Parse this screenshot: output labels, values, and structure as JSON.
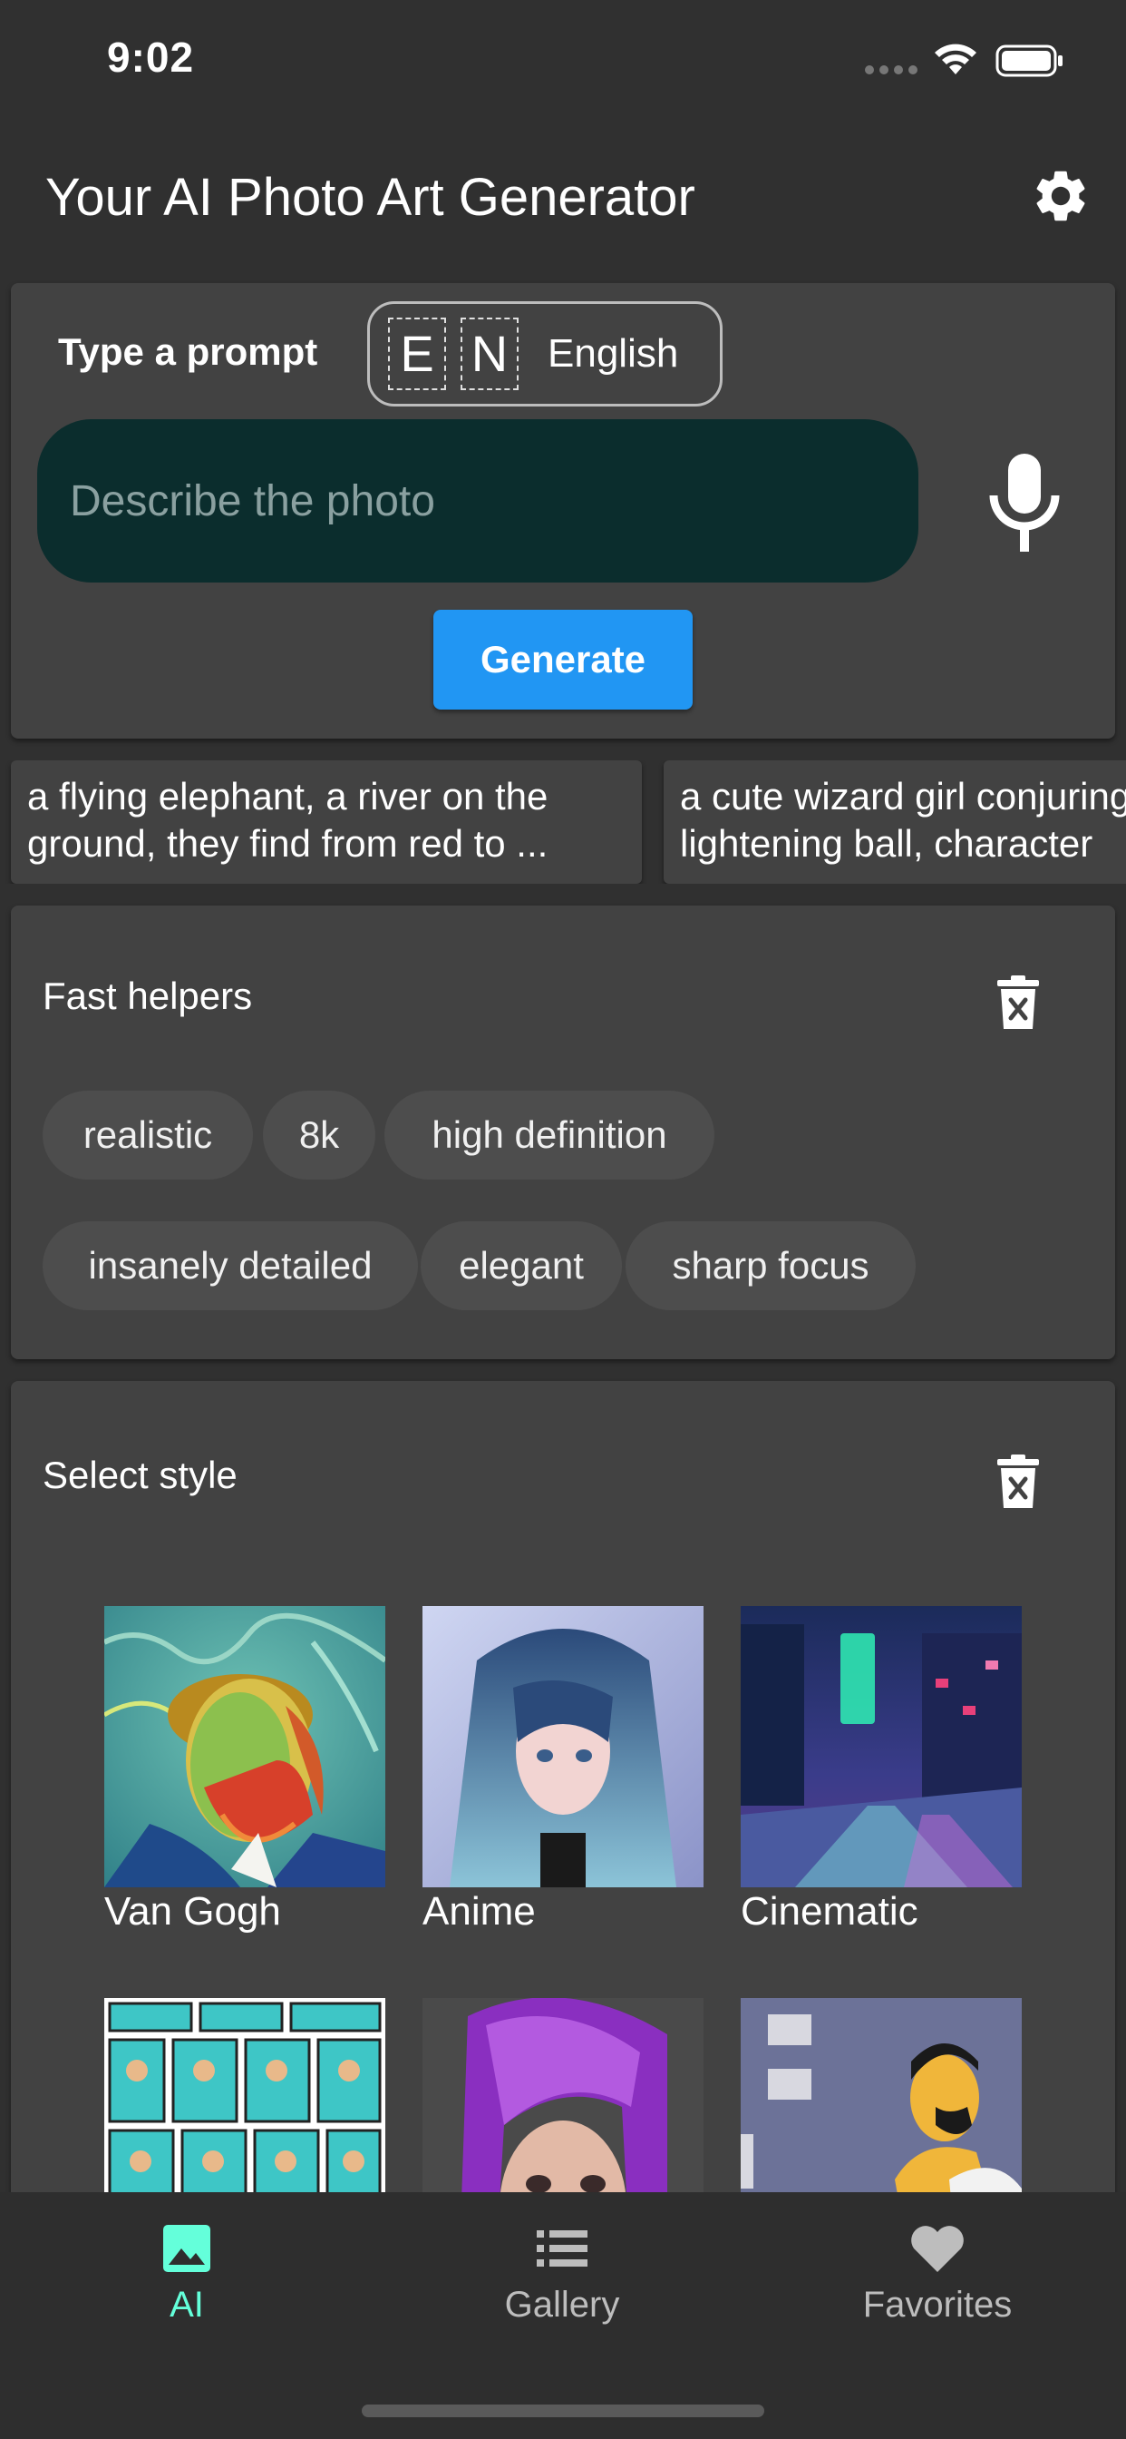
{
  "status_bar": {
    "time": "9:02"
  },
  "app_bar": {
    "title": "Your AI Photo Art Generator",
    "settings_icon": "gear-icon"
  },
  "prompt": {
    "label": "Type a prompt",
    "language": {
      "letter1": "E",
      "letter2": "N",
      "name": "English"
    },
    "input": {
      "value": "",
      "placeholder": "Describe the photo"
    },
    "mic_icon": "microphone-icon",
    "generate_label": "Generate"
  },
  "suggestions": [
    {
      "line1": "a flying elephant, a river on the",
      "line2": "ground, they find from red to ..."
    },
    {
      "line1": "a cute wizard girl conjuring",
      "line2": "lightening ball, character"
    }
  ],
  "fast_helpers": {
    "title": "Fast helpers",
    "chips": [
      "realistic",
      "8k",
      "high definition",
      "insanely detailed",
      "elegant",
      "sharp focus"
    ]
  },
  "style": {
    "title": "Select style",
    "items": [
      {
        "label": "Van Gogh"
      },
      {
        "label": "Anime"
      },
      {
        "label": "Cinematic"
      },
      {
        "label": ""
      },
      {
        "label": ""
      },
      {
        "label": ""
      }
    ]
  },
  "bottom_nav": {
    "items": [
      {
        "label": "AI",
        "icon": "image-icon",
        "active": true
      },
      {
        "label": "Gallery",
        "icon": "list-icon",
        "active": false
      },
      {
        "label": "Favorites",
        "icon": "heart-icon",
        "active": false
      }
    ]
  },
  "colors": {
    "accent": "#64ffda",
    "primary_button": "#2196f3",
    "input_bg": "#0b2d2d",
    "card_bg": "#424242",
    "background": "#303030"
  }
}
